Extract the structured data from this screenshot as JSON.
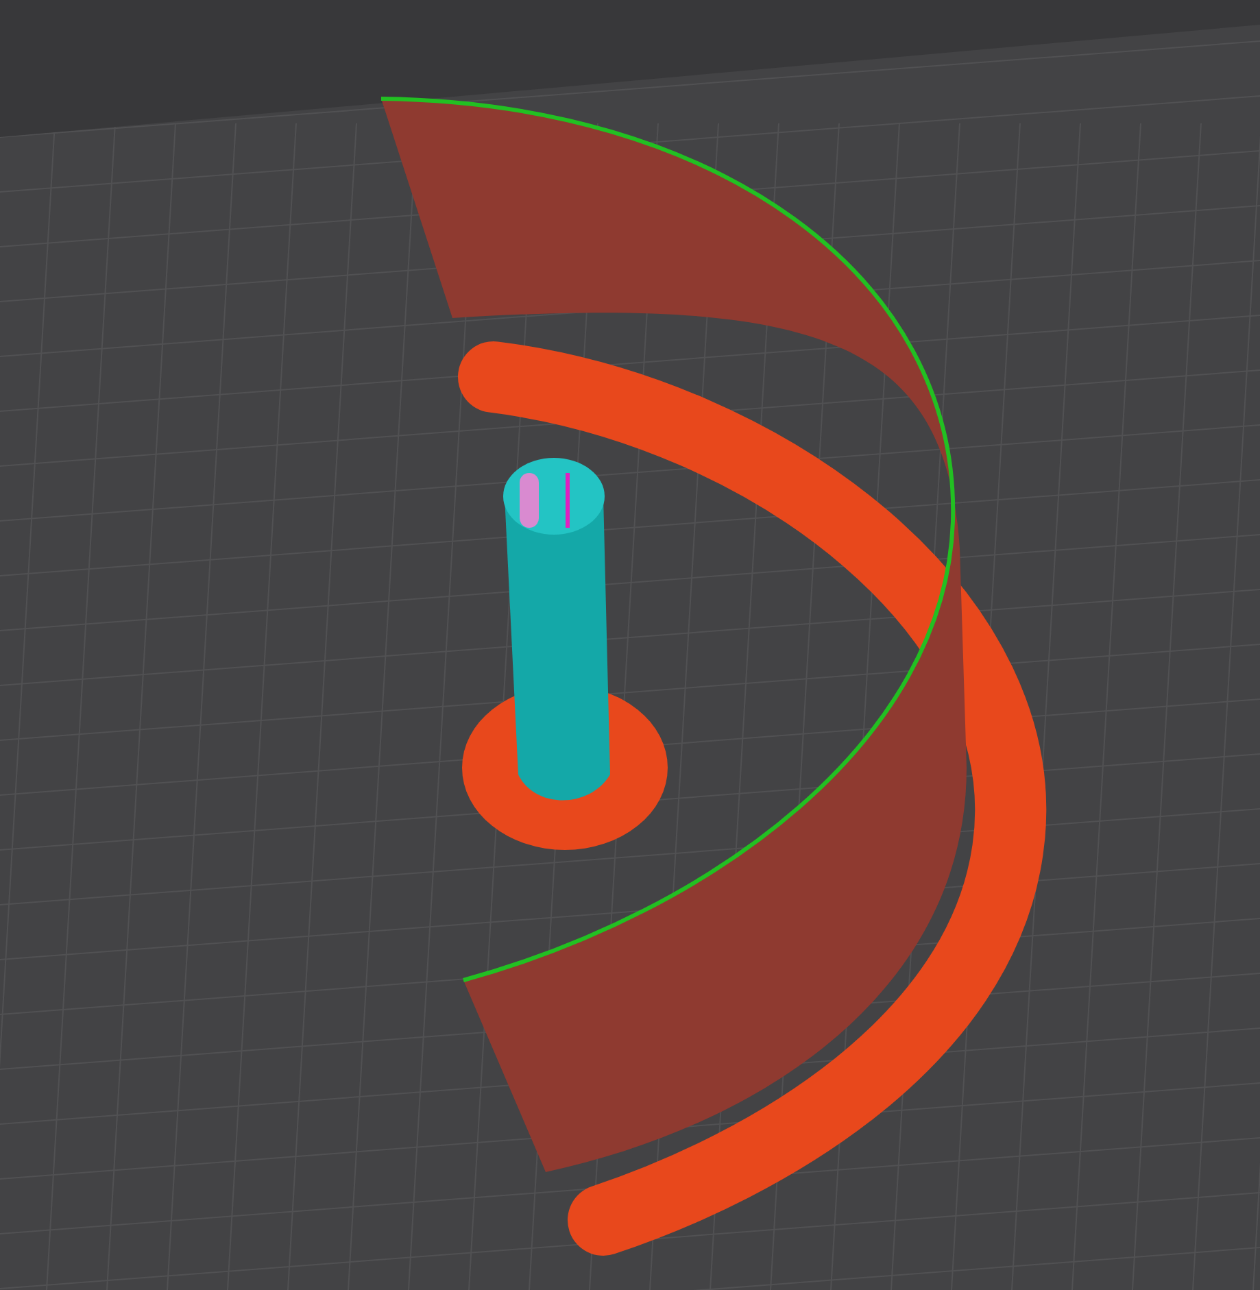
{
  "viewport": {
    "kind": "print-preview",
    "grid": true
  }
}
